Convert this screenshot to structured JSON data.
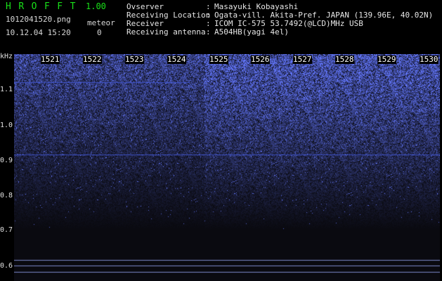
{
  "header": {
    "app_name": "HROFFT",
    "version": "1.00",
    "filename": "1012041520.png",
    "meteor_label": "meteor",
    "meteor_count": "0",
    "datetime": "10.12.04 15:20"
  },
  "station": [
    {
      "label": "Ovserver",
      "value": "Masayuki Kobayashi"
    },
    {
      "label": "Receiving Location",
      "value": "Ogata-vill. Akita-Pref. JAPAN (139.96E, 40.02N)"
    },
    {
      "label": "Receiver",
      "value": "ICOM IC-575 53.7492(@LCD)MHz USB"
    },
    {
      "label": "Receiving antenna",
      "value": "A504HB(yagi 4el)"
    }
  ],
  "separator": ":",
  "spectrogram": {
    "y_unit": "kHz",
    "y_ticks": [
      "1.1",
      "1.0",
      "0.9",
      "0.8",
      "0.7",
      "0.6"
    ],
    "x_minutes": [
      "1521",
      "1522",
      "1523",
      "1524",
      "1525",
      "1526",
      "1527",
      "1528",
      "1529",
      "1530"
    ],
    "colors": {
      "background": "#000010",
      "signal": "#2a4cff",
      "bright": "#b0c8ff",
      "grid": "#7a86c8"
    }
  }
}
